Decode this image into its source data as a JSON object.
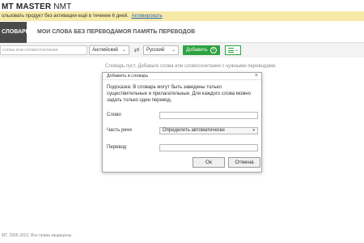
{
  "app": {
    "title_bold": "MT MASTER",
    "title_thin": "NMT"
  },
  "banner": {
    "text": "ользовать продукт без активации ещё в течение 6 дней.",
    "link": "Активировать"
  },
  "tabs": [
    {
      "label": "СЛОВАРЬ",
      "active": true
    },
    {
      "label": "МОИ СЛОВА БЕЗ ПЕРЕВОДА",
      "active": false
    },
    {
      "label": "МОЯ ПАМЯТЬ ПЕРЕВОДОВ",
      "active": false
    }
  ],
  "toolbar": {
    "search_placeholder": "слова или словосочетания",
    "source_language": "Английский",
    "target_language": "Русский",
    "add_label": "Добавить"
  },
  "empty_hint": "Словарь пуст. Добавьте слова или словосочетания с нужными переводами.",
  "dialog": {
    "title": "Добавить в словарь",
    "close": "×",
    "hint": "Подсказка: В словарь могут быть заведены только существительные и прилагательные. Для каждого слова можно задать только один перевод.",
    "word_label": "Слово",
    "word_value": "",
    "pos_label": "Часть речи",
    "pos_value": "Определить автоматически",
    "translation_label": "Перевод",
    "translation_value": "",
    "ok_label": "Ок",
    "cancel_label": "Отмена"
  },
  "footer": "МТ, 2005-2022. Все права защищены."
}
